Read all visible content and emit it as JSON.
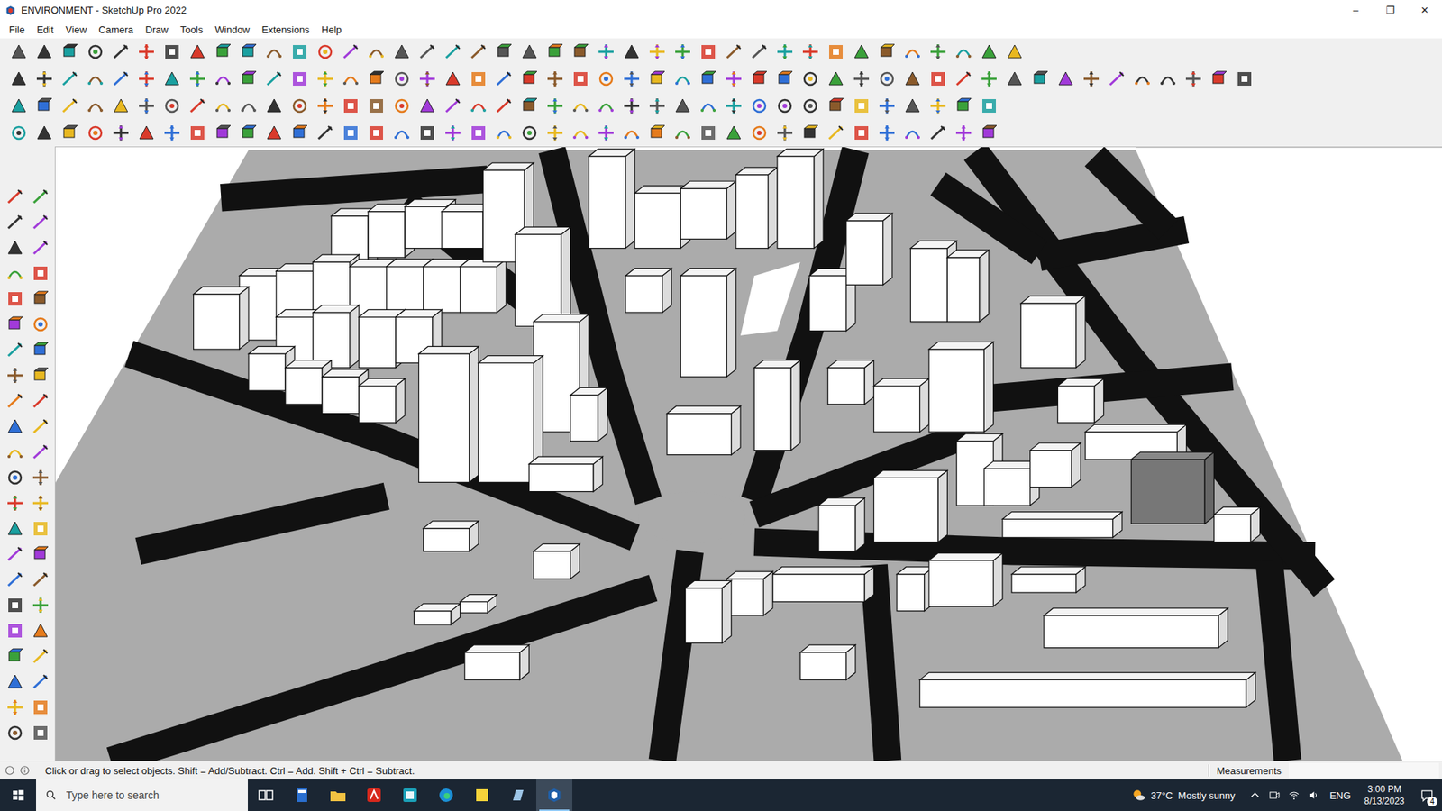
{
  "window": {
    "title": "ENVIRONMENT - SketchUp Pro 2022",
    "controls": [
      "–",
      "❐",
      "✕"
    ]
  },
  "menu": [
    "File",
    "Edit",
    "View",
    "Camera",
    "Draw",
    "Tools",
    "Window",
    "Extensions",
    "Help"
  ],
  "status_bar": {
    "hint": "Click or drag to select objects. Shift = Add/Subtract. Ctrl = Add. Shift + Ctrl = Subtract.",
    "measurements_label": "Measurements"
  },
  "taskbar": {
    "search_placeholder": "Type here to search",
    "weather": "37°C  Mostly sunny",
    "language": "ENG",
    "time": "3:00 PM",
    "date": "8/13/2023",
    "notifications": "4",
    "apps": [
      {
        "name": "task-view",
        "selected": false
      },
      {
        "name": "calculator",
        "selected": false
      },
      {
        "name": "file-explorer",
        "selected": false
      },
      {
        "name": "acrobat",
        "selected": false
      },
      {
        "name": "app",
        "selected": false
      },
      {
        "name": "edge",
        "selected": false
      },
      {
        "name": "sticky-notes",
        "selected": false
      },
      {
        "name": "layout",
        "selected": false
      },
      {
        "name": "sketchup",
        "selected": true
      }
    ]
  }
}
